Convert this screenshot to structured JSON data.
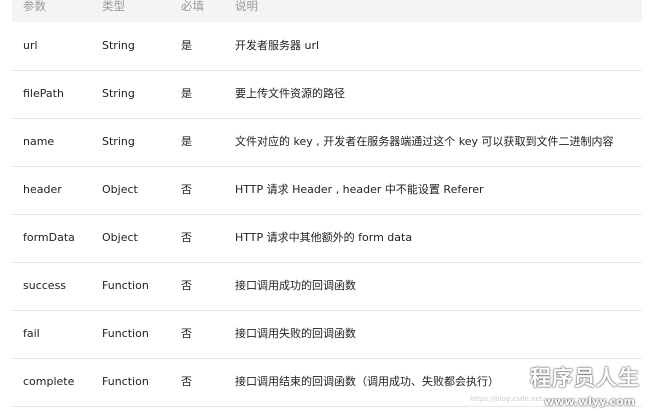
{
  "header": {
    "param": "参数",
    "type": "类型",
    "required": "必填",
    "description": "说明"
  },
  "rows": [
    {
      "param": "url",
      "type": "String",
      "required": "是",
      "description": "开发者服务器 url"
    },
    {
      "param": "filePath",
      "type": "String",
      "required": "是",
      "description": "要上传文件资源的路径"
    },
    {
      "param": "name",
      "type": "String",
      "required": "是",
      "description": "文件对应的 key , 开发者在服务器端通过这个 key 可以获取到文件二进制内容"
    },
    {
      "param": "header",
      "type": "Object",
      "required": "否",
      "description": "HTTP 请求 Header , header 中不能设置 Referer"
    },
    {
      "param": "formData",
      "type": "Object",
      "required": "否",
      "description": "HTTP 请求中其他额外的 form data"
    },
    {
      "param": "success",
      "type": "Function",
      "required": "否",
      "description": "接口调用成功的回调函数"
    },
    {
      "param": "fail",
      "type": "Function",
      "required": "否",
      "description": "接口调用失败的回调函数"
    },
    {
      "param": "complete",
      "type": "Function",
      "required": "否",
      "description": "接口调用结束的回调函数（调用成功、失败都会执行）"
    }
  ],
  "watermark": {
    "title": "程序员人生",
    "url": "www.wlyy.com",
    "faint_url": "https://blog.csdn.net"
  }
}
